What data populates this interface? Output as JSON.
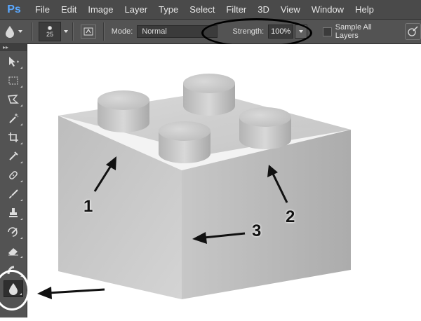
{
  "app": {
    "logo": "Ps"
  },
  "menubar": {
    "items": [
      "File",
      "Edit",
      "Image",
      "Layer",
      "Type",
      "Select",
      "Filter",
      "3D",
      "View",
      "Window",
      "Help"
    ]
  },
  "options": {
    "brush_size": "25",
    "mode_label": "Mode:",
    "mode_value": "Normal",
    "strength_label": "Strength:",
    "strength_value": "100%",
    "sample_all_layers_label": "Sample All Layers"
  },
  "tools": {
    "header": "▸▸",
    "items": [
      "move-tool-icon",
      "marquee-tool-icon",
      "lasso-tool-icon",
      "magic-wand-icon",
      "crop-tool-icon",
      "eyedropper-icon",
      "healing-brush-icon",
      "brush-tool-icon",
      "clone-stamp-icon",
      "history-brush-icon",
      "eraser-icon",
      "gradient-tool-icon",
      "blur-tool-icon"
    ]
  },
  "annotations": {
    "labels": [
      "1",
      "2",
      "3"
    ]
  },
  "colors": {
    "menubar": "#4a4a4a",
    "optionsbar": "#535353",
    "brick": "#bdbdbd",
    "ps_blue": "#5aa8ff"
  }
}
